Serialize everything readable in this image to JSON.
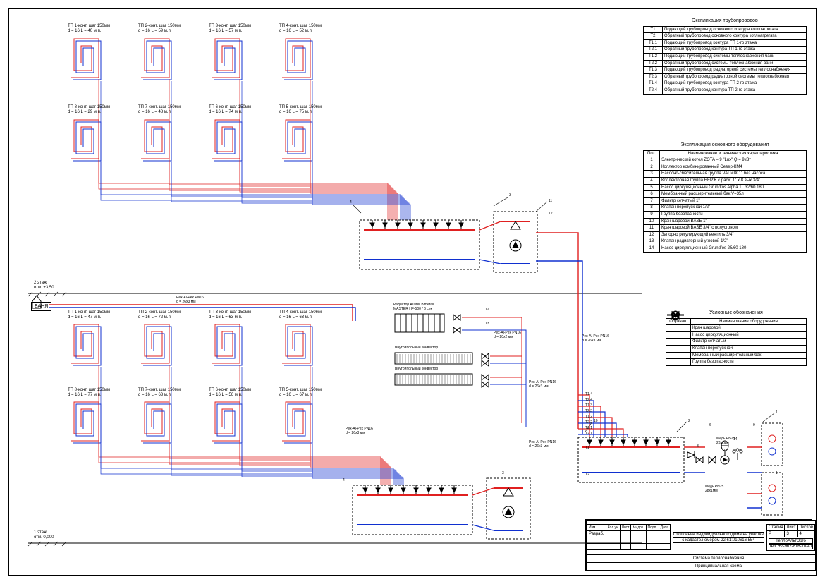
{
  "colors": {
    "supply": "#e02020",
    "return": "#1030d0",
    "frame": "#000"
  },
  "floor2": {
    "level_label": "2 этаж",
    "level_mark": "отм. +3,50",
    "loops_top": [
      {
        "n": "ТП 1",
        "t": "ТП 1-конт. шаг 150мм",
        "d": "d = 16 L = 40 м.п."
      },
      {
        "n": "ТП 2",
        "t": "ТП 2-конт. шаг 150мм",
        "d": "d = 16 L = 59 м.п."
      },
      {
        "n": "ТП 3",
        "t": "ТП 3-конт. шаг 150мм",
        "d": "d = 16 L = 57 м.п."
      },
      {
        "n": "ТП 4",
        "t": "ТП 4-конт. шаг 150мм",
        "d": "d = 16 L = 52 м.п."
      }
    ],
    "loops_bot": [
      {
        "n": "ТП 8",
        "t": "ТП 8-конт. шаг 150мм",
        "d": "d = 16 L = 29 м.п."
      },
      {
        "n": "ТП 7",
        "t": "ТП 7-конт. шаг 150мм",
        "d": "d = 16 L = 48 м.п."
      },
      {
        "n": "ТП 6",
        "t": "ТП 6-конт. шаг 150мм",
        "d": "d = 16 L = 74 м.п."
      },
      {
        "n": "ТП 5",
        "t": "ТП 5-конт. шаг 150мм",
        "d": "d = 16 L = 75 м.п."
      }
    ]
  },
  "floor1": {
    "level_label": "1 этаж",
    "level_mark": "отм. 0,000",
    "loops_top": [
      {
        "n": "ТП 1",
        "t": "ТП 1-конт. шаг 150мм",
        "d": "d = 16 L = 47 м.п."
      },
      {
        "n": "ТП 2",
        "t": "ТП 2-конт. шаг 150мм",
        "d": "d = 16 L = 72 м.п."
      },
      {
        "n": "ТП 3",
        "t": "ТП 3-конт. шаг 150мм",
        "d": "d = 16 L = 63 м.п."
      },
      {
        "n": "ТП 4",
        "t": "ТП 4-конт. шаг 150мм",
        "d": "d = 16 L = 63 м.п."
      }
    ],
    "loops_bot": [
      {
        "n": "ТП 8",
        "t": "ТП 8-конт. шаг 150мм",
        "d": "d = 16 L = 77 м.п."
      },
      {
        "n": "ТП 7",
        "t": "ТП 7-конт. шаг 150мм",
        "d": "d = 16 L = 63 м.п."
      },
      {
        "n": "ТП 6",
        "t": "ТП 6-конт. шаг 150мм",
        "d": "d = 16 L = 56 м.п."
      },
      {
        "n": "ТП 5",
        "t": "ТП 5-конт. шаг 150мм",
        "d": "d = 16 L = 67 м.п."
      }
    ]
  },
  "banya": "БАНЯ",
  "pipe_labels": {
    "pex26_1": "Pex-Al-Pex PN16",
    "pex26_1d": "d = 26x3 мм",
    "pex26_2": "Pex-Al-Pex PN16",
    "pex26_2d": "d = 26x3 мм",
    "pex26_3": "Pex-Al-Pex PN16",
    "pex26_3d": "d = 26x3 мм",
    "pex26_4": "Pex-Al-Pex PN16",
    "pex26_4d": "d = 26x3 мм",
    "pex26_5": "Pex-Al-Pex PN16",
    "pex26_5d": "d = 26x3 мм",
    "pex20": "Pex-Al-Pex PN16",
    "pex20d": "d = 20x2 мм",
    "cu1": "Медь PN25",
    "cu1d": "28x1мм",
    "cu2": "Медь PN25",
    "cu2d": "28x1мм"
  },
  "radiator": {
    "t1": "Радиатор Auster Bimetall",
    "t2": "MASTER HF-500 / 6 сек"
  },
  "convector": "Внутрипольный конвектор",
  "line_tags": [
    "Т1.4",
    "Т2.4",
    "Т1.3",
    "Т2.3",
    "Т1.2",
    "Т2.2",
    "Т1.1",
    "Т2.1",
    "Т1",
    "Т2"
  ],
  "callouts": [
    "1",
    "2",
    "3",
    "4",
    "5",
    "6",
    "7",
    "8",
    "9",
    "10",
    "11",
    "12",
    "13",
    "14"
  ],
  "pipes": {
    "title": "Экспликация трубопроводов",
    "rows": [
      [
        "Т1",
        "Подающий трубопровод основного контура котлоагрегата"
      ],
      [
        "Т2",
        "Обратный трубопровод основного контура котлоагрегата"
      ],
      [
        "Т1.1",
        "Подающий трубопровод контура ТП 1-го этажа"
      ],
      [
        "Т2.1",
        "Обратный трубопровод контура ТП 1-го этажа"
      ],
      [
        "Т1.2",
        "Подающий трубопровод системы теплоснабжения бани"
      ],
      [
        "Т2.2",
        "Обратный трубопровод системы теплоснабжения бани"
      ],
      [
        "Т1.3",
        "Подающий трубопровод радиаторной системы теплоснабжения"
      ],
      [
        "Т2.3",
        "Обратный трубопровод радиаторной системы теплоснабжения"
      ],
      [
        "Т1.4",
        "Подающий трубопровод контура ТП 2-го этажа"
      ],
      [
        "Т2.4",
        "Обратный трубопровод контура ТП 2-го этажа"
      ]
    ]
  },
  "equip": {
    "title": "Экспликация основного оборудования",
    "head": [
      "Поз.",
      "Наименование и техническая характеристика"
    ],
    "rows": [
      [
        "1",
        "Электрический котел ZOTA – 9 \"Lux\" Q = 9кВт"
      ],
      [
        "2",
        "Коллектор комбинированный Север-КМ4"
      ],
      [
        "3",
        "Насосно-смесительная группа VALMIX 1\" без насоса"
      ],
      [
        "4",
        "Коллекторная группа HEPЖ с расх. 1\" x 8 вых 3/4\""
      ],
      [
        "5",
        "Насос циркуляционный Grundfos Alpha 1L 32/60 180"
      ],
      [
        "6",
        "Мембранный расширительный бак V=35л"
      ],
      [
        "7",
        "Фильтр сетчатый 1\""
      ],
      [
        "8",
        "Клапан перепускной 1/2\""
      ],
      [
        "9",
        "Группа безопасности"
      ],
      [
        "10",
        "Кран шаровой BASE 1\""
      ],
      [
        "11",
        "Кран шаровой BASE 3/4\" с полусгоном"
      ],
      [
        "12",
        "Запорно регулирующий вентиль 3/4\""
      ],
      [
        "13",
        "Клапан радиаторный угловой 1/2\""
      ],
      [
        "14",
        "Насос циркуляционный Grundfos 25/60 180"
      ]
    ]
  },
  "legend": {
    "title": "Условные обозначения",
    "head": [
      "Обознач.",
      "Наименование оборудования"
    ],
    "rows": [
      [
        "valve",
        "Кран шаровой"
      ],
      [
        "pump",
        "Насос циркуляционный"
      ],
      [
        "filter",
        "Фильтр сетчатый"
      ],
      [
        "bypass",
        "Клапан перепускной"
      ],
      [
        "tank",
        "Мембранный расширительный бак"
      ],
      [
        "safety",
        "Группа безопасности"
      ]
    ]
  },
  "titleblock": {
    "project1": "Отопление индивидуального дома на участке",
    "project2": "с кадастр.номером 22:61:010616:554",
    "sheet_type": "Система теплоснабжения",
    "drawing": "Принципиальная схема",
    "stage": "Стадия",
    "sheet": "Лист",
    "sheets": "Листов",
    "stage_v": "Р",
    "sheet_v": "3",
    "sheets_v": "4",
    "company": "ТеплоАльтЭрго",
    "tel": "тел. +7-962-816-70-41",
    "cols": [
      "Изм.",
      "Кол.уч",
      "Лист",
      "№ док.",
      "Подп.",
      "Дата"
    ],
    "roles": [
      "Разраб."
    ]
  }
}
